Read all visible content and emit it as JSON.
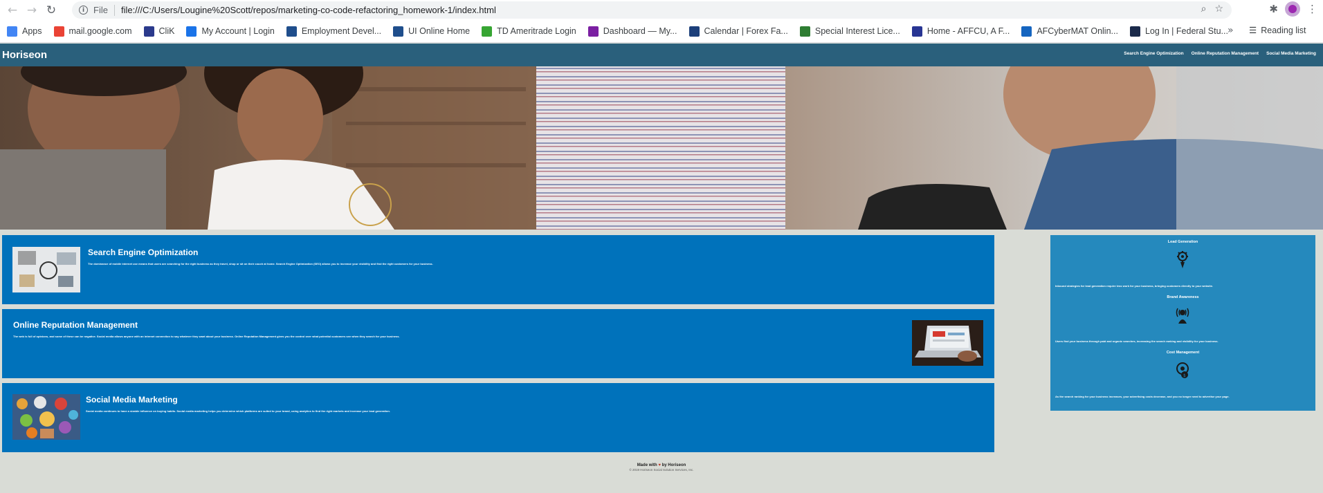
{
  "browser": {
    "scheme": "File",
    "url": "file:///C:/Users/Lougine%20Scott/repos/marketing-co-code-refactoring_homework-1/index.html",
    "bookmarks": [
      {
        "label": "Apps",
        "icon": "apps-grid-icon",
        "color": "#4285f4"
      },
      {
        "label": "mail.google.com",
        "icon": "gmail-icon",
        "color": "#ea4335"
      },
      {
        "label": "CliK",
        "icon": "clik-icon",
        "color": "#2b3a8c"
      },
      {
        "label": "My Account | Login",
        "icon": "account-icon",
        "color": "#1a73e8"
      },
      {
        "label": "Employment Devel...",
        "icon": "edd-icon",
        "color": "#1f4e8c"
      },
      {
        "label": "UI Online Home",
        "icon": "edd-icon",
        "color": "#1f4e8c"
      },
      {
        "label": "TD Ameritrade Login",
        "icon": "td-icon",
        "color": "#37a533"
      },
      {
        "label": "Dashboard — My...",
        "icon": "dashboard-icon",
        "color": "#7b1fa2"
      },
      {
        "label": "Calendar | Forex Fa...",
        "icon": "forex-icon",
        "color": "#1c3f7a"
      },
      {
        "label": "Special Interest Lice...",
        "icon": "seal-icon",
        "color": "#2e7d32"
      },
      {
        "label": "Home - AFFCU, A F...",
        "icon": "affcu-icon",
        "color": "#283593"
      },
      {
        "label": "AFCyberMAT Onlin...",
        "icon": "afcyber-icon",
        "color": "#1565c0"
      },
      {
        "label": "Log In | Federal Stu...",
        "icon": "fsa-icon",
        "color": "#1b2a4a"
      }
    ],
    "reading_list": "Reading list"
  },
  "site": {
    "logo": "Horiseon",
    "nav": [
      "Search Engine Optimization",
      "Online Reputation Management",
      "Social Media Marketing"
    ]
  },
  "content": [
    {
      "title": "Search Engine Optimization",
      "text": "The dominance of mobile internet use means that users are searching for the right business as they travel, shop or sit on their couch at home. Search Engine Optimization (SEO) allows you to increase your visibility and find the right customers for your business."
    },
    {
      "title": "Online Reputation Management",
      "text": "The web is full of opinions, and some of these can be negative. Social media allows anyone with an internet connection to say whatever they want about your business. Online Reputation Management gives you the control over what potential customers see when they search for your business."
    },
    {
      "title": "Social Media Marketing",
      "text": "Social media continues to have a sizable influence on buying habits. Social media marketing helps you determine which platforms are suited to your brand, using analytics to find the right markets and increase your lead generation."
    }
  ],
  "benefits": [
    {
      "title": "Lead Generation",
      "icon": "lead-generation-icon",
      "text": "Inbound strategies for lead generation require less work for your business, bringing customers directly to your website."
    },
    {
      "title": "Brand Awareness",
      "icon": "brand-awareness-icon",
      "text": "Users find your business through paid and organic searches, increasing the search ranking and visibility for your business."
    },
    {
      "title": "Cost Management",
      "icon": "cost-management-icon",
      "text": "As the search ranking for your business increases, your advertising costs decrease, and you no longer need to advertise your page."
    }
  ],
  "footer": {
    "made_prefix": "Made with",
    "made_suffix": "by Horiseon",
    "copyright": "© 2019 Horiseon Social Solution Services, Inc."
  },
  "colors": {
    "header": "#2a607c",
    "card": "#0072bb",
    "benefits": "#2589bd",
    "page": "#d9dcd6"
  }
}
